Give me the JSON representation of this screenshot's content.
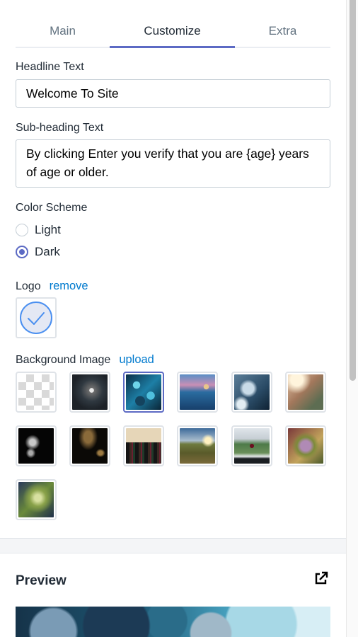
{
  "tabs": [
    {
      "label": "Main",
      "active": false
    },
    {
      "label": "Customize",
      "active": true
    },
    {
      "label": "Extra",
      "active": false
    }
  ],
  "headline": {
    "label": "Headline Text",
    "value": "Welcome To Site"
  },
  "subheading": {
    "label": "Sub-heading Text",
    "value": "By clicking Enter you verify that you are {age} years of age or older."
  },
  "color_scheme": {
    "label": "Color Scheme",
    "options": [
      {
        "label": "Light",
        "selected": false
      },
      {
        "label": "Dark",
        "selected": true
      }
    ]
  },
  "logo": {
    "label": "Logo",
    "remove_link": "remove",
    "icon": "check-circle-icon"
  },
  "background_image": {
    "label": "Background Image",
    "upload_link": "upload",
    "selected_index": 2,
    "thumbnails": [
      {
        "name": "none-transparent"
      },
      {
        "name": "corridor"
      },
      {
        "name": "blue-beads"
      },
      {
        "name": "blue-bokeh-road"
      },
      {
        "name": "blue-smoke"
      },
      {
        "name": "cigar-sunlight"
      },
      {
        "name": "white-smoke-black"
      },
      {
        "name": "golden-smoke"
      },
      {
        "name": "wine-bottles"
      },
      {
        "name": "vineyard-sunset"
      },
      {
        "name": "wine-glass-vineyard"
      },
      {
        "name": "cannabis-purple"
      },
      {
        "name": "cannabis-green"
      }
    ]
  },
  "preview": {
    "title": "Preview",
    "icon": "external-link-icon"
  },
  "colors": {
    "accent": "#5c6ac4",
    "link": "#007ace",
    "text": "#212b36",
    "muted": "#637381"
  }
}
